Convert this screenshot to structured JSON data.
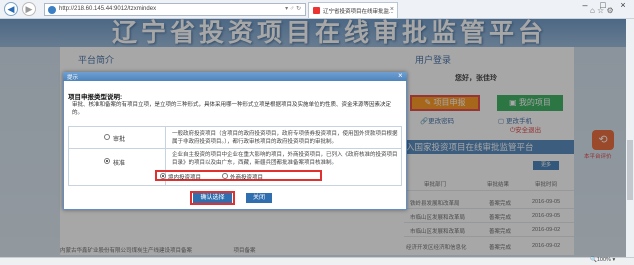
{
  "browser": {
    "url": "http://218.60.145.44:9012/tzxmindex",
    "address_controls": "▾ ♂ ↻",
    "tab_title": "辽宁省投资项目在线审批监...",
    "tab_close": "×",
    "minimize": "–",
    "maximize": "□",
    "close": "×",
    "tools": "⌂ ☆ ⚙",
    "zoom": "🔍100% ▾"
  },
  "site": {
    "title": "辽宁省投资项目在线审批监管平台"
  },
  "left_section": {
    "heading": "平台简介"
  },
  "login": {
    "heading": "用户登录",
    "welcome": "您好，张佳玲",
    "apply_button": "项目申报",
    "my_projects_button": "我的项目",
    "change_password": "更改密码",
    "change_phone": "更改手机",
    "safe_exit": "安全退出"
  },
  "platform_link": "入国家投资项目在线审批监管平台",
  "more_label": "更多",
  "table": {
    "headers": [
      "审批部门",
      "审批结果",
      "审批时间"
    ],
    "rows": [
      {
        "dept": "铁岭县发展和改革局",
        "result": "善案完成",
        "date": "2016-09-05"
      },
      {
        "dept": "市临山区发展和改革局",
        "result": "善案完成",
        "date": "2016-09-05"
      },
      {
        "dept": "市临山区发展和改革局",
        "result": "善案完成",
        "date": "2016-09-02"
      },
      {
        "dept": "经济开发区经济和信息化",
        "result": "善案完成",
        "date": "2016-09-02"
      }
    ]
  },
  "side_widget": {
    "icon": "⟲",
    "label": "本平台评价"
  },
  "bottom_row": {
    "text": "内蒙古华鑫矿业股份有限公司煤炭生产线建设项目备案",
    "status": "项目备案"
  },
  "dialog": {
    "title": "提示",
    "close": "×",
    "heading": "项目申报类型说明:",
    "description": "审批、核准和备案的有项目立项，是立项的三种形式，具体采用哪一种形式立项是根据项目及实施单位的性质、资金来源等因素决定的。",
    "options": [
      {
        "label": "审批",
        "selected": false,
        "text": "一般政府投资项目（含项目的政府投资项目，政府专项债券投资项目，使用国外贷款项目根据属于非政府投资项目。），都行政审核项目的政府投资项目的审批制。"
      },
      {
        "label": "核准",
        "selected": true,
        "text": "企业自主投资的项目中企业在重大影响的项目，外商投资项目，已列入《政府核准的投资项目目录》的项目以及由广东，西藏，新疆兵团都批准备案项目核准制。"
      }
    ],
    "sub_options": [
      {
        "label": "境内投资项目",
        "selected": true
      },
      {
        "label": "外商投资项目",
        "selected": false
      }
    ],
    "confirm_button": "确认选择",
    "close_button": "关闭"
  },
  "colors": {
    "banner": "#5a8cc1",
    "apply_button": "#ff8a00",
    "my_projects_button": "#1fa64a",
    "highlight": "#e03030",
    "dialog_button": "#2f6fb0"
  }
}
